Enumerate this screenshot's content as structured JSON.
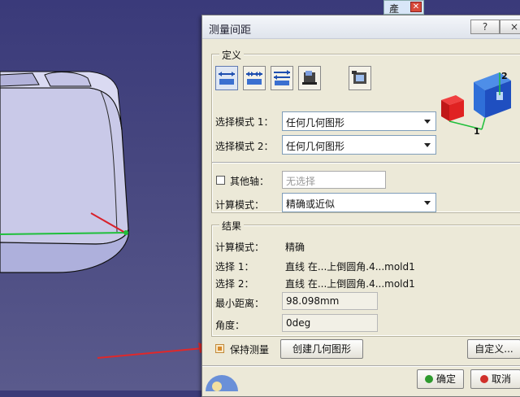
{
  "background_window": {
    "title": "產",
    "close_icon": "close-icon"
  },
  "dialog": {
    "title": "测量间距",
    "help_button": "?",
    "close_button": "×",
    "definition": {
      "legend": "定义",
      "mode_icons": [
        "measure-between-icon",
        "measure-chain-icon",
        "measure-fan-icon",
        "measure-item-icon",
        "measure-thickness-icon"
      ],
      "select_mode_1_label": "选择模式 1：",
      "select_mode_1_value": "任何几何图形",
      "select_mode_2_label": "选择模式 2：",
      "select_mode_2_value": "任何几何图形",
      "other_axis_label": "其他轴：",
      "other_axis_placeholder": "无选择",
      "calc_mode_label": "计算模式：",
      "calc_mode_value": "精确或近似",
      "preview_labels": {
        "a": "2",
        "b": "1"
      }
    },
    "results": {
      "legend": "结果",
      "calc_mode_label": "计算模式：",
      "calc_mode_value": "精确",
      "select1_label": "选择 1：",
      "select1_value": "直线 在...上倒圆角.4...mold1",
      "select2_label": "选择 2：",
      "select2_value": "直线 在...上倒圆角.4...mold1",
      "min_distance_label": "最小距离：",
      "min_distance_value": "98.098mm",
      "angle_label": "角度：",
      "angle_value": "0deg"
    },
    "keep_measure_label": "保持测量",
    "keep_measure_checked": true,
    "create_geometry_button": "创建几何图形",
    "customize_button": "自定义...",
    "ok_button": "确定",
    "cancel_button": "取消",
    "colors": {
      "ok": "#2e9a2e",
      "cancel": "#d0302a",
      "accent": "#6079b0"
    }
  }
}
